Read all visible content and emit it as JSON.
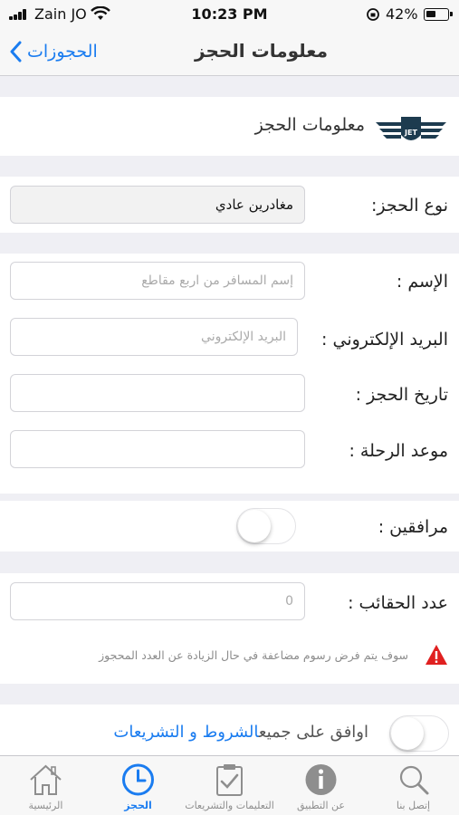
{
  "status_bar": {
    "carrier": "Zain JO",
    "time": "10:23 PM",
    "battery": "42%"
  },
  "nav": {
    "title": "معلومات الحجز",
    "back_label": "الحجوزات"
  },
  "section_header": {
    "title": "معلومات الحجز",
    "logo_text": "JET"
  },
  "form": {
    "booking_type": {
      "label": "نوع الحجز:",
      "value": "مغادرين عادي"
    },
    "name": {
      "label": "الإسم :",
      "placeholder": "إسم المسافر من اربع مقاطع"
    },
    "email": {
      "label": "البريد الإلكتروني :",
      "placeholder": "البريد الإلكتروني"
    },
    "booking_date": {
      "label": "تاريخ الحجز :"
    },
    "trip_time": {
      "label": "موعد الرحلة :"
    },
    "companions": {
      "label": "مرافقين :"
    },
    "bags": {
      "label": "عدد الحقائب :",
      "placeholder": "0"
    },
    "warning": "سوف يتم فرض رسوم مضاعفة في حال الزيادة عن العدد المحجوز",
    "terms": {
      "prefix": "اوافق على جميع",
      "link": "الشروط و التشريعات"
    }
  },
  "tabs": [
    {
      "label": "إتصل بنا",
      "icon": "search-icon"
    },
    {
      "label": "عن التطبيق",
      "icon": "info-icon"
    },
    {
      "label": "التعليمات والتشريعات",
      "icon": "clipboard-check-icon"
    },
    {
      "label": "الحجز",
      "icon": "clock-icon",
      "active": true
    },
    {
      "label": "الرئيسية",
      "icon": "home-icon"
    }
  ],
  "colors": {
    "accent": "#1a7cf0",
    "warning": "#e02020",
    "logo": "#1d3b4f"
  }
}
